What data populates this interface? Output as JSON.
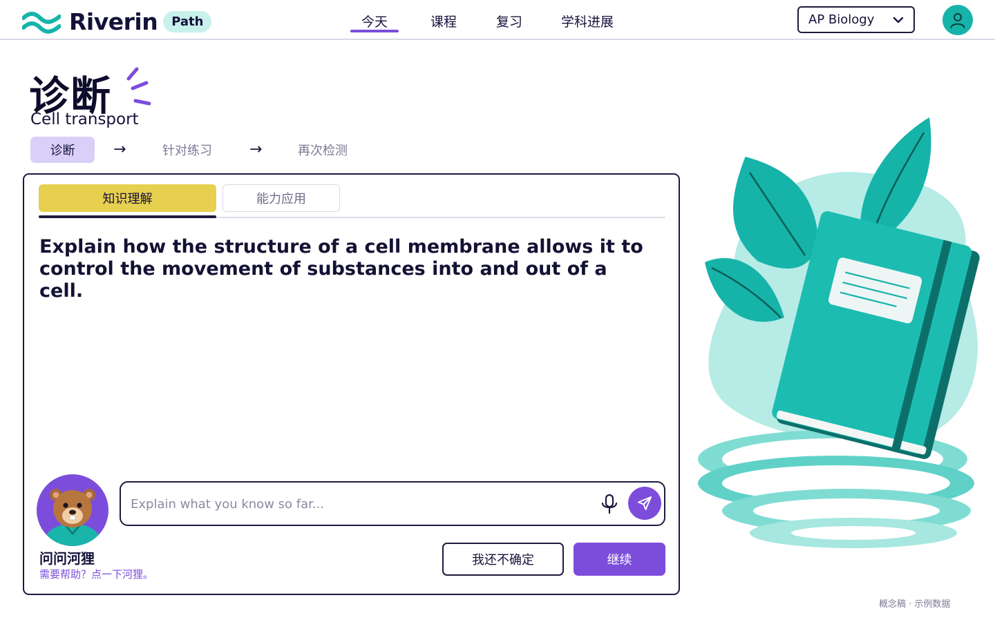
{
  "header": {
    "brand": "Riverin",
    "badge": "Path",
    "nav": [
      {
        "label": "今天",
        "active": true
      },
      {
        "label": "课程",
        "active": false
      },
      {
        "label": "复习",
        "active": false
      },
      {
        "label": "学科进展",
        "active": false
      }
    ],
    "course": {
      "selected": "AP Biology",
      "icon": "chevron-down-icon"
    },
    "profile_icon": "user-icon"
  },
  "page": {
    "title": "诊断",
    "subtitle": "Cell transport",
    "steps": [
      {
        "label": "诊断",
        "state": "current"
      },
      {
        "label": "针对练习",
        "state": "pending"
      },
      {
        "label": "再次检测",
        "state": "pending"
      }
    ],
    "step_arrow": "→"
  },
  "card": {
    "tabs": [
      {
        "label": "知识理解",
        "active": true
      },
      {
        "label": "能力应用",
        "active": false
      }
    ],
    "question": "Explain how the structure of a cell membrane allows it to control the movement of substances into and out of a cell.",
    "answer": {
      "value": "",
      "placeholder": "Explain what you know so far..."
    },
    "mascot": {
      "name": "问问河狸",
      "hint": "需要帮助？点一下河狸。"
    },
    "buttons": {
      "unsure": "我还不确定",
      "continue": "继续"
    }
  },
  "footer": {
    "note": "概念稿 · 示例数据"
  },
  "colors": {
    "accent": "#7c4ddb",
    "teal": "#16b3a9",
    "tab_active": "#e7cf4f",
    "step_current": "#d9cff8",
    "ink": "#141233"
  }
}
